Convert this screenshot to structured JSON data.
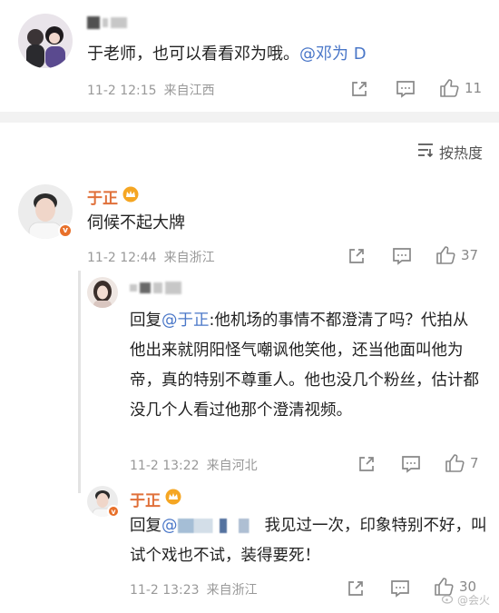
{
  "comments": {
    "top": {
      "text": "于老师，也可以看看邓为哦。",
      "mention": "@邓为 D",
      "date": "11-2 12:15",
      "location": "来自江西",
      "likes": "11"
    },
    "sort_label": "按热度",
    "main": {
      "username": "于正",
      "text": "伺候不起大牌",
      "date": "11-2 12:44",
      "location": "来自浙江",
      "likes": "37"
    },
    "reply1": {
      "prefix": "回复",
      "mention": "@于正",
      "text": ":他机场的事情不都澄清了吗？代拍从他出来就阴阳怪气嘲讽他笑他，还当他面叫他为帝，真的特别不尊重人。他也没几个粉丝，估计都没几个人看过他那个澄清视频。",
      "date": "11-2 13:22",
      "location": "来自河北",
      "likes": "7"
    },
    "reply2": {
      "username": "于正",
      "prefix": "回复",
      "mention": "@",
      "text": "我见过一次，印象特别不好，叫试个戏也不试，装得要死！",
      "date": "11-2 13:23",
      "location": "来自浙江",
      "likes": "30"
    }
  },
  "watermark": "@会火",
  "icons": {
    "share": "share-icon",
    "comment": "comment-icon",
    "like": "like-icon",
    "sort": "sort-icon",
    "vip": "vip-crown-icon"
  },
  "colors": {
    "mention": "#4a77c8",
    "username": "#e0703a",
    "meta": "#999999"
  }
}
